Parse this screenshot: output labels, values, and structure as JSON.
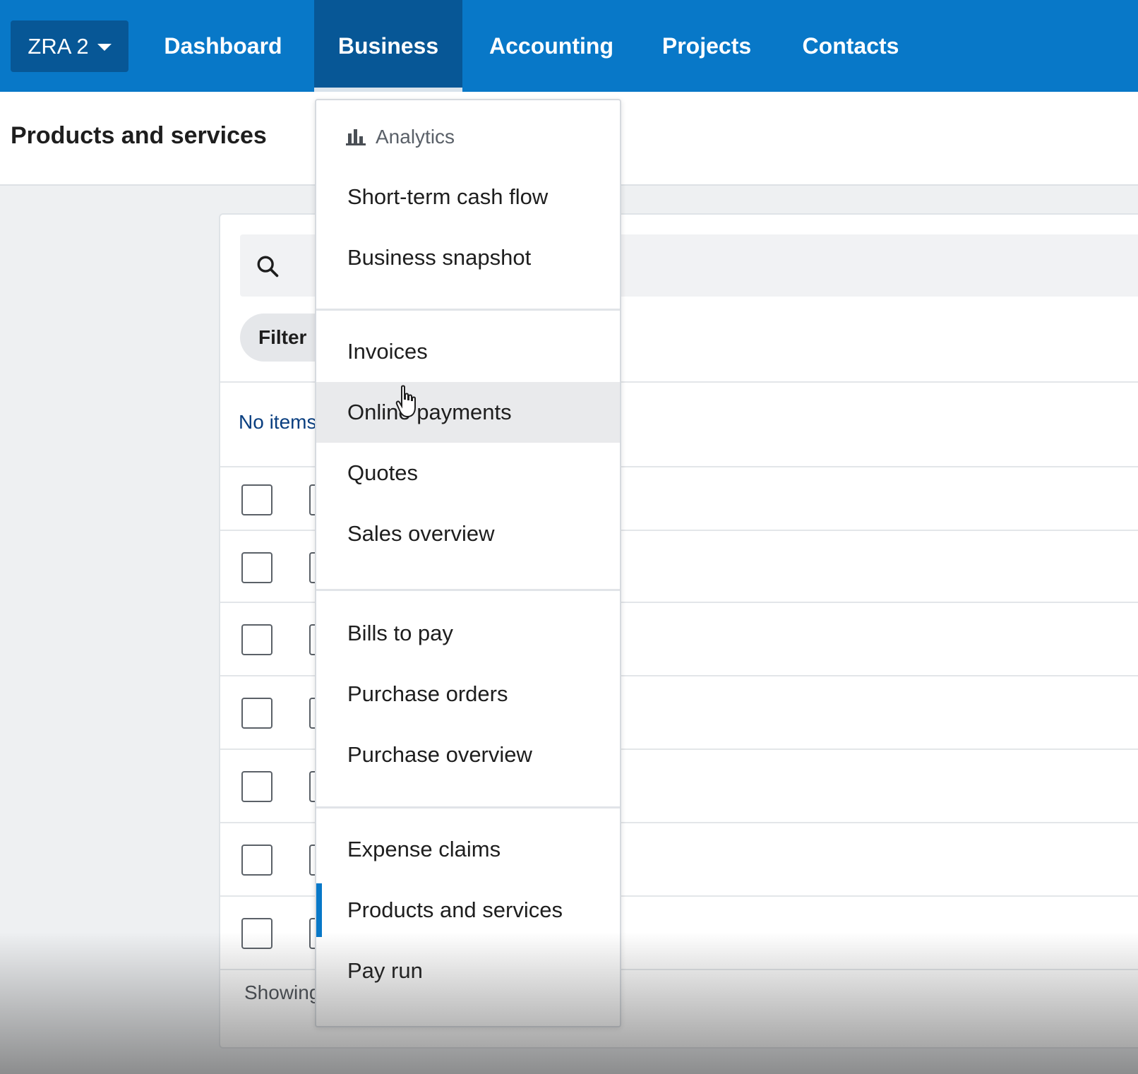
{
  "topnav": {
    "org_name": "ZRA 2",
    "items": [
      {
        "label": "Dashboard"
      },
      {
        "label": "Business"
      },
      {
        "label": "Accounting"
      },
      {
        "label": "Projects"
      },
      {
        "label": "Contacts"
      }
    ],
    "active_item": "Business",
    "colors": {
      "bar": "#0878c8",
      "active": "#075796"
    }
  },
  "page": {
    "title": "Products and services",
    "filter_label": "Filter",
    "empty_text": "No items",
    "footer_text": "Showing"
  },
  "search": {
    "icon": "search-icon"
  },
  "business_menu": {
    "header": "Analytics",
    "groups": [
      [
        "Short-term cash flow",
        "Business snapshot"
      ],
      [
        "Invoices",
        "Online payments",
        "Quotes",
        "Sales overview"
      ],
      [
        "Bills to pay",
        "Purchase orders",
        "Purchase overview"
      ],
      [
        "Expense claims",
        "Products and services",
        "Pay run"
      ]
    ],
    "hovered_item": "Online payments",
    "current_item": "Products and services"
  }
}
